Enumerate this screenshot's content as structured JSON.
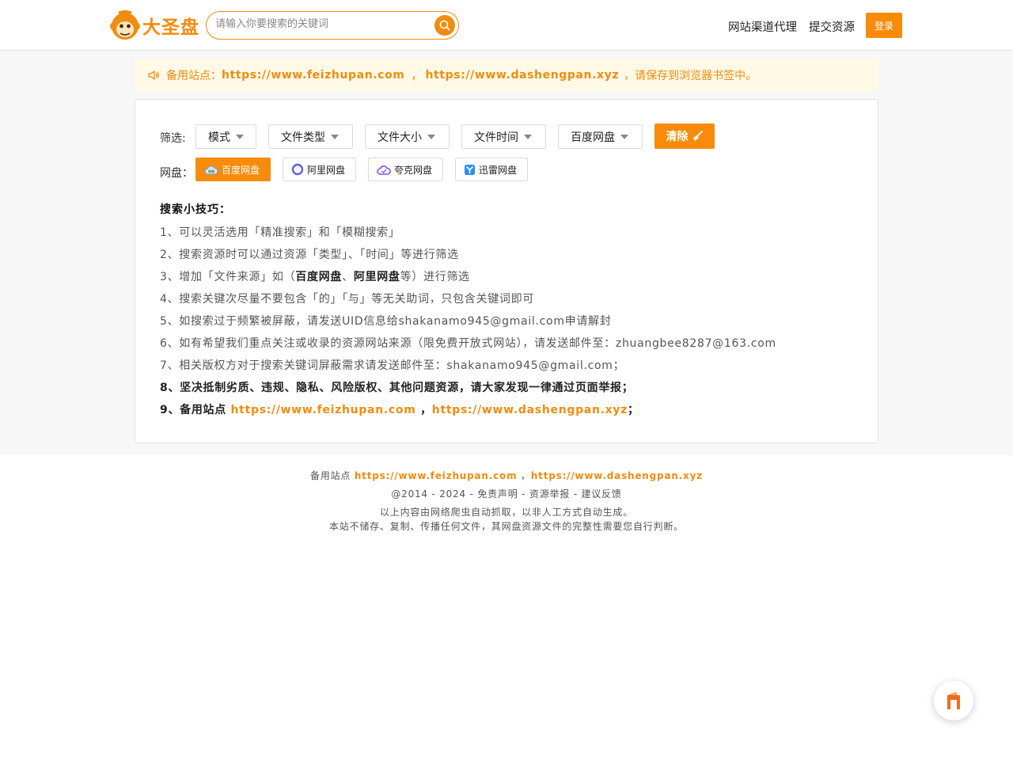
{
  "header": {
    "logo_text": "大圣盘",
    "search_placeholder": "请输入你要搜索的关键词",
    "nav": [
      "网站渠道代理",
      "提交资源"
    ],
    "login_label": "登录"
  },
  "notice": {
    "prefix": "备用站点：",
    "url1": "https://www.feizhupan.com",
    "comma": "，",
    "url2": "https://www.dashengpan.xyz",
    "suffix": "，请保存到浏览器书签中。"
  },
  "filters": {
    "label": "筛选:",
    "dropdowns": [
      "模式",
      "文件类型",
      "文件大小",
      "文件时间",
      "百度网盘"
    ],
    "clear_label": "清除"
  },
  "pans": {
    "label": "网盘：",
    "items": [
      "百度网盘",
      "阿里网盘",
      "夸克网盘",
      "迅雷网盘"
    ]
  },
  "tips": {
    "title": "搜索小技巧：",
    "t1": "1、可以灵活选用「精准搜索」和「模糊搜索」",
    "t2": "2、搜索资源时可以通过资源「类型」、「时间」等进行筛选",
    "t3_a": "3、增加「文件来源」如（",
    "t3_b": "百度网盘",
    "t3_c": "、",
    "t3_d": "阿里网盘",
    "t3_e": "等）进行筛选",
    "t4": "4、搜索关键次尽量不要包含「的」「与」等无关助词，只包含关键词即可",
    "t5": "5、如搜索过于频繁被屏蔽，请发送UID信息给shakanamo945@gmail.com申请解封",
    "t6": "6、如有希望我们重点关注或收录的资源网站来源（限免费开放式网站），请发送邮件至：zhuangbee8287@163.com",
    "t7": "7、相关版权方对于搜索关键词屏蔽需求请发送邮件至：shakanamo945@gmail.com；",
    "t8": "8、坚决抵制劣质、违规、隐私、风险版权、其他问题资源，请大家发现一律通过页面举报；",
    "t9_a": "9、备用站点 ",
    "t9_url1": "https://www.feizhupan.com",
    "t9_b": " ，",
    "t9_url2": "https://www.dashengpan.xyz",
    "t9_c": "；"
  },
  "footer": {
    "backup_prefix": "备用站点 ",
    "url1": "https://www.feizhupan.com",
    "comma": " ，",
    "url2": "https://www.dashengpan.xyz",
    "copyright": "@2014 - 2024",
    "dash": " - ",
    "links": [
      "免责声明",
      "资源举报",
      "建议反馈"
    ],
    "disclaimer1": "以上内容由网络爬虫自动抓取，以非人工方式自动生成。",
    "disclaimer2": "本站不储存、复制、传播任何文件，其网盘资源文件的完整性需要您自行判断。"
  },
  "colors": {
    "accent": "#f08c0f",
    "button": "#f88c0a",
    "notice_bg": "#fff9e6"
  }
}
